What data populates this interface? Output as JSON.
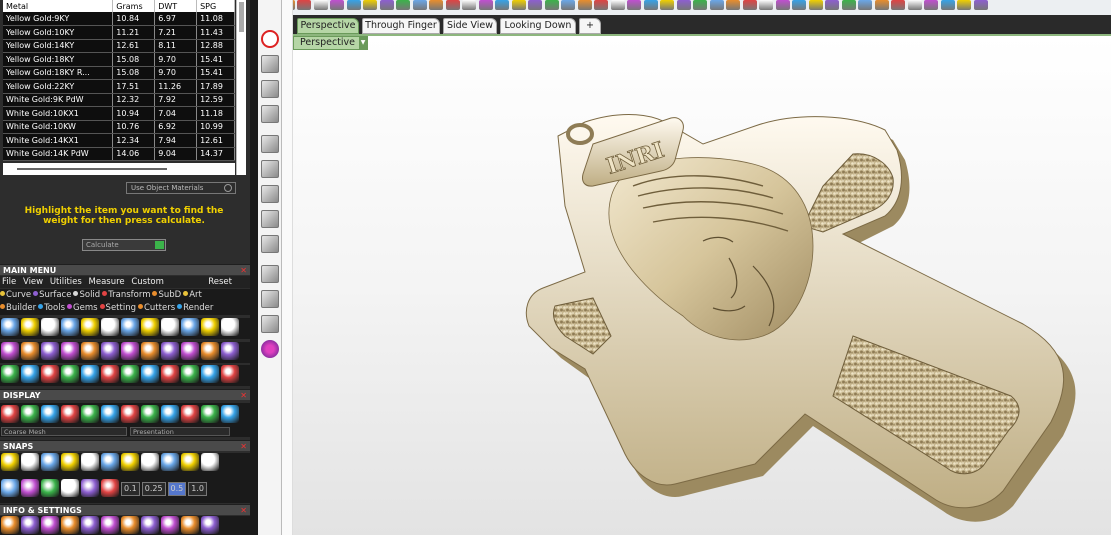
{
  "metal_table": {
    "headers": [
      "Metal",
      "Grams",
      "DWT",
      "SPG"
    ],
    "rows": [
      [
        "Yellow Gold:9KY",
        "10.84",
        "6.97",
        "11.08"
      ],
      [
        "Yellow Gold:10KY",
        "11.21",
        "7.21",
        "11.43"
      ],
      [
        "Yellow Gold:14KY",
        "12.61",
        "8.11",
        "12.88"
      ],
      [
        "Yellow Gold:18KY",
        "15.08",
        "9.70",
        "15.41"
      ],
      [
        "Yellow Gold:18KY R...",
        "15.08",
        "9.70",
        "15.41"
      ],
      [
        "Yellow Gold:22KY",
        "17.51",
        "11.26",
        "17.89"
      ],
      [
        "White Gold:9K PdW",
        "12.32",
        "7.92",
        "12.59"
      ],
      [
        "White Gold:10KX1",
        "10.94",
        "7.04",
        "11.18"
      ],
      [
        "White Gold:10KW",
        "10.76",
        "6.92",
        "10.99"
      ],
      [
        "White Gold:14KX1",
        "12.34",
        "7.94",
        "12.61"
      ],
      [
        "White Gold:14K PdW",
        "14.06",
        "9.04",
        "14.37"
      ]
    ]
  },
  "use_object_materials": "Use Object Materials",
  "hint": "Highlight the item you want to find the weight for then press calculate.",
  "calculate_label": "Calculate",
  "main_menu": {
    "title": "MAIN MENU",
    "menus": [
      "File",
      "View",
      "Utilities",
      "Measure",
      "Custom"
    ],
    "reset": "Reset",
    "categories_row1": [
      {
        "label": "Curve",
        "color": "#e8c23a"
      },
      {
        "label": "Surface",
        "color": "#8d5fd0"
      },
      {
        "label": "Solid",
        "color": "#d8d8d8"
      },
      {
        "label": "Transform",
        "color": "#e04343"
      },
      {
        "label": "SubD",
        "color": "#e88d2d"
      },
      {
        "label": "Art",
        "color": "#e8c23a"
      }
    ],
    "categories_row2": [
      {
        "label": "Builder",
        "color": "#e88d2d"
      },
      {
        "label": "Tools",
        "color": "#36a3e8"
      },
      {
        "label": "Gems",
        "color": "#c04fd0"
      },
      {
        "label": "Setting",
        "color": "#e04343"
      },
      {
        "label": "Cutters",
        "color": "#e88d2d"
      },
      {
        "label": "Render",
        "color": "#36a3e8"
      }
    ]
  },
  "display": {
    "title": "DISPLAY",
    "mesh_select": "Coarse Mesh",
    "mode_select": "Presentation"
  },
  "snaps": {
    "title": "SNAPS",
    "values": [
      "0.1",
      "0.25",
      "0.5",
      "1.0"
    ]
  },
  "info_settings": {
    "title": "INFO & SETTINGS"
  },
  "viewport": {
    "tabs": [
      "Perspective",
      "Through Finger",
      "Side View",
      "Looking Down"
    ],
    "active_tab": "Perspective",
    "view_select": "Perspective",
    "inscription": "INRI"
  },
  "colors": {
    "accent_green": "#b6d6a6",
    "hint_yellow": "#f0d000",
    "gold": "#d9c9a0"
  }
}
